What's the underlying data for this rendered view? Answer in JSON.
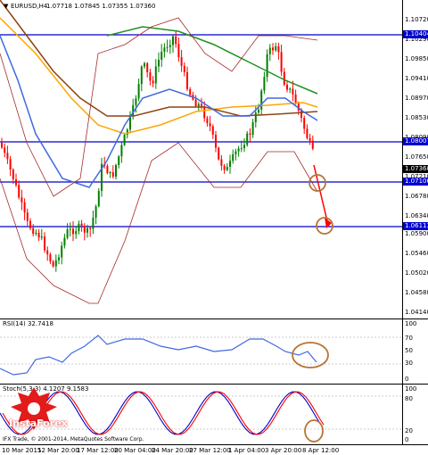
{
  "header": {
    "symbol": "EURUSD,H4",
    "ohlc": "1.07718 1.07845 1.07355 1.07360"
  },
  "price_scale": [
    "1.10720",
    "1.10290",
    "1.09850",
    "1.09410",
    "1.08970",
    "1.08530",
    "1.08090",
    "1.07650",
    "1.07210",
    "1.06780",
    "1.06340",
    "1.05900",
    "1.05460",
    "1.05020",
    "1.04580",
    "1.04140"
  ],
  "price_tags": {
    "level_top": "1.10404",
    "level_mid": "1.08007",
    "current": "1.07360",
    "level_lower": "1.07106",
    "level_bottom": "1.06113"
  },
  "rsi": {
    "title": "RSI(14) 32.7418",
    "scale": [
      "100",
      "70",
      "50",
      "30",
      "0"
    ]
  },
  "stoch": {
    "title": "Stoch(5,3,3) 4.1207 9.1583",
    "scale": [
      "100",
      "80",
      "20",
      "0"
    ]
  },
  "xaxis": [
    "10 Mar 2015",
    "12 Mar 20:00",
    "17 Mar 12:00",
    "20 Mar 04:00",
    "24 Mar 20:00",
    "27 Mar 12:00",
    "1 Apr 04:00",
    "3 Apr 20:00",
    "8 Apr 12:00"
  ],
  "footer": "IFX Trade, © 2001-2014, MetaQuotes Software Corp.",
  "logo": {
    "text": "InstaForex"
  },
  "colors": {
    "bull_candle": "#008000",
    "bear_candle": "#ff0000",
    "level_line": "#0000cc",
    "ma_green": "#209020",
    "ma_brown": "#8b4513",
    "ma_orange": "#ffa500",
    "ma_blue": "#4169e1",
    "bollinger": "#a52a2a",
    "annotation": "#b87333"
  }
}
